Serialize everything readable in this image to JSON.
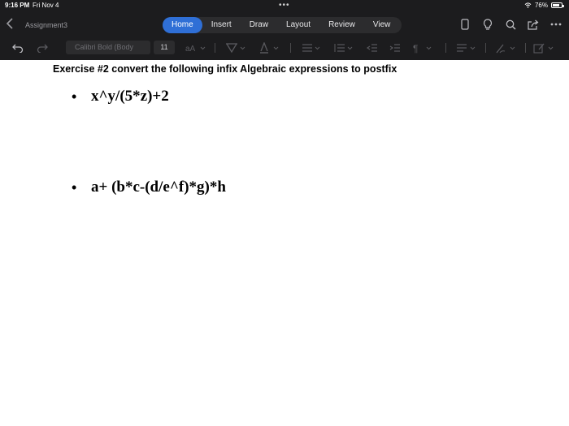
{
  "status": {
    "time": "9:16 PM",
    "date": "Fri Nov 4",
    "battery": "76%",
    "battery_level": 0.76
  },
  "app": {
    "document_title": "Assignment3"
  },
  "tabs": [
    {
      "label": "Home",
      "active": true
    },
    {
      "label": "Insert",
      "active": false
    },
    {
      "label": "Draw",
      "active": false
    },
    {
      "label": "Layout",
      "active": false
    },
    {
      "label": "Review",
      "active": false
    },
    {
      "label": "View",
      "active": false
    }
  ],
  "ribbon": {
    "font_name": "Calibri Bold (Body",
    "font_size": "11"
  },
  "document": {
    "heading": "Exercise #2 convert the following infix Algebraic expressions to postfix",
    "expressions": [
      "x^y/(5*z)+2",
      "a+ (b*c-(d/e^f)*g)*h"
    ]
  },
  "colors": {
    "chrome_bg": "#1c1c1e",
    "accent": "#2f6fd6",
    "page_bg": "#ffffff"
  },
  "icons": [
    "back-chevron-icon",
    "tablet-icon",
    "lightbulb-icon",
    "search-icon",
    "share-icon",
    "more-icon",
    "undo-icon",
    "redo-icon",
    "font-size-icon",
    "highlight-icon",
    "font-color-icon",
    "bullets-icon",
    "numbering-icon",
    "outdent-icon",
    "indent-icon",
    "paragraph-icon",
    "align-icon",
    "styles-icon",
    "editor-icon",
    "wifi-icon",
    "battery-icon"
  ]
}
